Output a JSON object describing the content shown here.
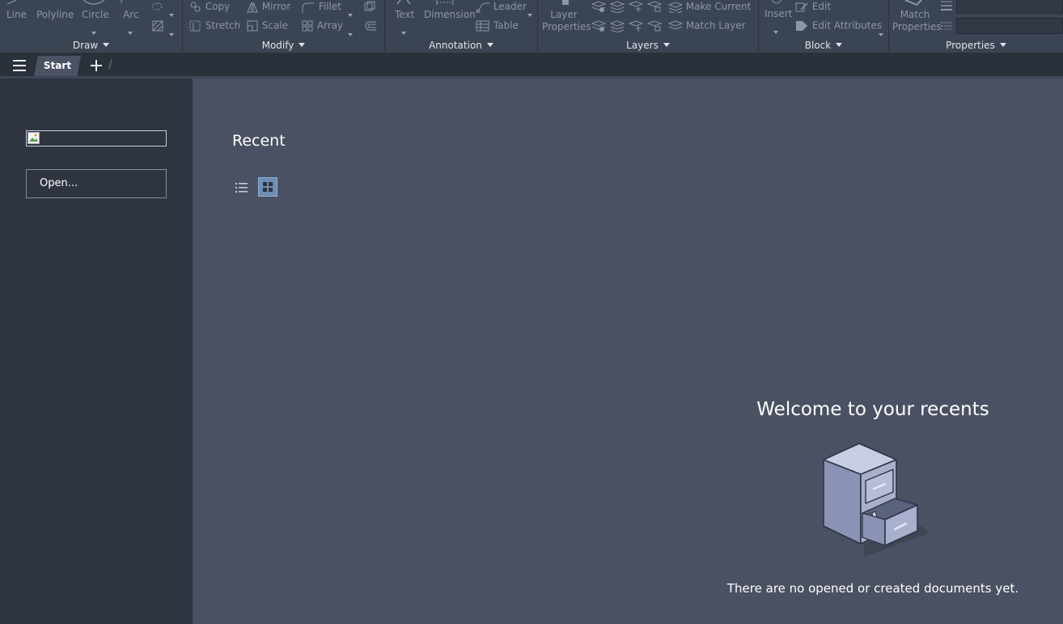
{
  "ribbon": {
    "draw": {
      "title": "Draw",
      "line": "Line",
      "polyline": "Polyline",
      "circle": "Circle",
      "arc": "Arc"
    },
    "modify": {
      "title": "Modify",
      "copy": "Copy",
      "mirror": "Mirror",
      "fillet": "Fillet",
      "stretch": "Stretch",
      "scale": "Scale",
      "array": "Array"
    },
    "annotation": {
      "title": "Annotation",
      "text": "Text",
      "dimension": "Dimension",
      "leader": "Leader",
      "table": "Table"
    },
    "layers": {
      "title": "Layers",
      "layer_properties_1": "Layer",
      "layer_properties_2": "Properties",
      "make_current": "Make Current",
      "match_layer": "Match Layer"
    },
    "block": {
      "title": "Block",
      "insert": "Insert",
      "edit": "Edit",
      "edit_attributes": "Edit Attributes"
    },
    "properties": {
      "title": "Properties",
      "match_1": "Match",
      "match_2": "Properties"
    }
  },
  "tabs": {
    "start": "Start"
  },
  "sidebar": {
    "open_button": "Open..."
  },
  "main": {
    "recent_title": "Recent",
    "welcome_title": "Welcome to your recents",
    "empty_message": "There are no opened or created documents yet."
  },
  "colors": {
    "ribbon_bg": "#3b4453",
    "sidebar_bg": "#2e3440",
    "main_bg": "#4a5162",
    "accent": "#6d8db4"
  }
}
